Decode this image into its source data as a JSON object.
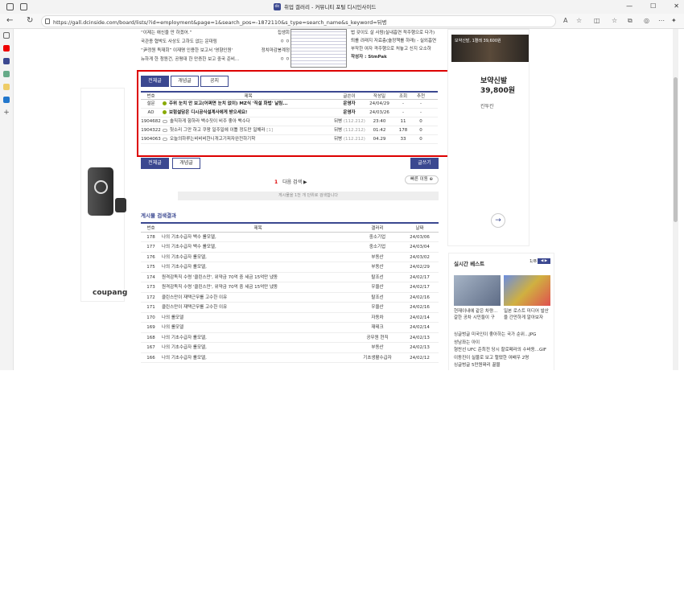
{
  "window": {
    "tab_title": "취업 갤러리 - 커뮤니티 포털 디시인사이드",
    "url": "https://gall.dcinside.com/board/lists/?id=employment&page=1&search_pos=-1872110&s_type=search_name&s_keyword=뒤병",
    "min": "—",
    "max": "☐",
    "close": "✕"
  },
  "top_list": [
    {
      "title": "“이제는 애신을 만 하겠어.”",
      "author": "집생회"
    },
    {
      "title": "국관종 협박도 사상도 고하도 없는 운대링",
      "author": "ㅇ ㅇ"
    },
    {
      "title": "“尹정원 독재회” 이재명 인용한 보고서 '영향인원'",
      "author": "정치마감봉계정"
    },
    {
      "title": "뉴하게 한 청원건, 공평대 한 만증한 보고 중국 준비...",
      "author": "ㅇ ㅇ"
    }
  ],
  "side_text": [
    "법 갖이도 살 사람(실내흡연 적주행으로 다가)",
    "퇴를 려래지 저료층(숄정책를 하래) - 실외흡연",
    "부작한 여자 격주행으로 처놓고 신지 오소하",
    "작성자 : StmPak"
  ],
  "tabs": [
    "전체글",
    "개념글",
    "공지"
  ],
  "table": {
    "headers": [
      "번호",
      "제목",
      "글쓴이",
      "작성일",
      "조회",
      "추천"
    ],
    "rows": [
      {
        "no": "설문",
        "title": "주위 눈치 안 보고(어쩌면 눈치 없이) MZ식 '직설 화법' 날림...",
        "author": "운영자",
        "date": "24/04/29",
        "views": "-",
        "recs": "-",
        "bold": true,
        "icon": "notice"
      },
      {
        "no": "AD",
        "title": "보험설담은 디시공식설계사에게 받으세요!",
        "author": "운영자",
        "date": "24/03/26",
        "views": "-",
        "recs": "-",
        "bold": true,
        "icon": "notice"
      },
      {
        "no": "1904682",
        "title": "솔직하게 함하라 백수짓이 비주 좋아 백수다",
        "author": "뒤병",
        "ip": "(112.212)",
        "date": "23:40",
        "views": "11",
        "recs": "0",
        "bold": false,
        "icon": "msg"
      },
      {
        "no": "1904322",
        "title": "헛소리 그만 하고 쿠팡 일주일에 이틀 정도만 일해라",
        "reply": "[1]",
        "author": "뒤병",
        "ip": "(112.212)",
        "date": "01:42",
        "views": "178",
        "recs": "0",
        "bold": false,
        "icon": "msg"
      },
      {
        "no": "1904063",
        "title": "오늘의하루는비비비한니개고기피자완전하기학",
        "author": "뒤병",
        "ip": "(112.212)",
        "date": "04.29",
        "views": "33",
        "recs": "0",
        "bold": false,
        "icon": "msg"
      }
    ]
  },
  "buttons": {
    "all": "전체글",
    "concept": "개념글",
    "write": "글쓰기",
    "quick": "빠른 이동 ⊕"
  },
  "pager": {
    "current": "1",
    "next": "다음 검색 ▶"
  },
  "no_result": "게시물을 1천 개 단위로 검색합니다",
  "search_section": {
    "title": "게시물 검색결과",
    "headers": [
      "번호",
      "제목",
      "갤러리",
      "날짜"
    ],
    "rows": [
      {
        "no": "178",
        "title": "나의 기초수급자 백수 롤모델,",
        "gallery": "중소기업",
        "date": "24/03/06"
      },
      {
        "no": "177",
        "title": "나의 기초수급자 백수 롤모델,",
        "gallery": "중소기업",
        "date": "24/03/04"
      },
      {
        "no": "176",
        "title": "나의 기초수급자 롤모델,",
        "gallery": "부동산",
        "date": "24/03/02"
      },
      {
        "no": "175",
        "title": "나의 기초수급자 롤모델,",
        "gallery": "부동산",
        "date": "24/02/29"
      },
      {
        "no": "174",
        "title": "원격감독직 수령 '클린스만', 위약금 70억 중 세금 15억만 냈동",
        "gallery": "탈조선",
        "date": "24/02/17"
      },
      {
        "no": "173",
        "title": "원격감독직 수령 '클린스만', 위약금 70억 중 세금 15억만 냈동",
        "gallery": "우울산",
        "date": "24/02/17"
      },
      {
        "no": "172",
        "title": "클린스만이 재택근무를 고수한 이유",
        "gallery": "탈조선",
        "date": "24/02/16"
      },
      {
        "no": "171",
        "title": "클린스만이 재택근무를 고수한 이유",
        "gallery": "우울산",
        "date": "24/02/16"
      },
      {
        "no": "170",
        "title": "나의 롤모델",
        "gallery": "자동차",
        "date": "24/02/14"
      },
      {
        "no": "169",
        "title": "나의 롤모델",
        "gallery": "재테크",
        "date": "24/02/14"
      },
      {
        "no": "168",
        "title": "나의 기초수급자 롤모델,",
        "gallery": "공무원 현직",
        "date": "24/02/13"
      },
      {
        "no": "167",
        "title": "나의 기초수급자 롤모델,",
        "gallery": "부동산",
        "date": "24/02/13"
      },
      {
        "no": "166",
        "title": "나의 기초수급자 롤모델,",
        "gallery": "기초생활수급자",
        "date": "24/02/12"
      }
    ]
  },
  "ad_left": {
    "brand": "coupang"
  },
  "right_banner": {
    "img_text": "보약신발, 1켤레 39,600원",
    "title": "보약신발 39,800원",
    "sub": "칸투칸",
    "arrow": "→"
  },
  "live_best": {
    "title": "실시간 베스트",
    "page": "1/8",
    "page_btn": "◀ ▶",
    "captions": [
      "현재이내에 같은 차량...갈한 공차 시민들이 구",
      "일본 로스트 미디어 발산을 간만하게 알아보자"
    ],
    "list": [
      "싱글벙글 미국인이 좋아하는 국가 순위...JPG",
      "성남좌는 아이",
      "형찬선 UFC 준최전 당시 할로페라의 수바동...GIF",
      "이동진이 실물로 보고 헐떴한 여배우 2명",
      "싱글벙글 5만원짜리 꿀물"
    ]
  },
  "colors": {
    "accent": "#3b4890",
    "highlight": "#dd0000"
  }
}
